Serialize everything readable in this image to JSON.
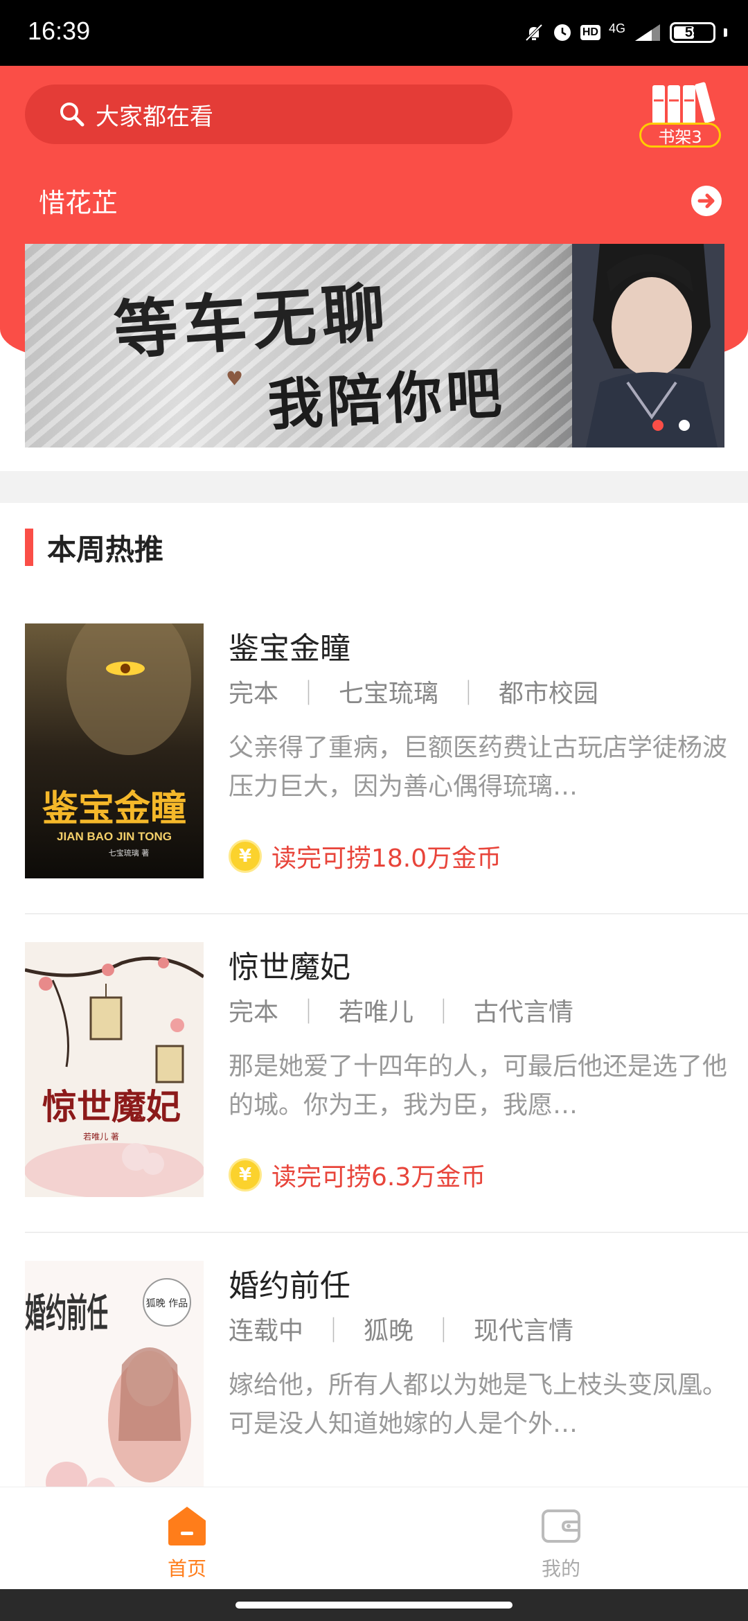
{
  "status_bar": {
    "time": "16:39",
    "network": "4G",
    "hd": "HD",
    "battery": "59",
    "battery_level": 0.59
  },
  "search": {
    "placeholder": "大家都在看"
  },
  "bookshelf": {
    "label": "书架3"
  },
  "author": {
    "name": "惜花芷"
  },
  "banner": {
    "line1": "等车无聊",
    "line2": "我陪你吧",
    "slides": 2,
    "active_slide": 1
  },
  "section": {
    "title": "本周热推"
  },
  "books": [
    {
      "title": "鉴宝金瞳",
      "status": "完本",
      "author": "七宝琉璃",
      "category": "都市校园",
      "desc": "父亲得了重病，巨额医药费让古玩店学徒杨波压力巨大，因为善心偶得琉璃…",
      "reward": "读完可捞18.0万金币",
      "cover_title": "鉴宝金瞳",
      "cover_pinyin": "JIAN BAO JIN TONG",
      "cover_author": "七宝琉璃 著"
    },
    {
      "title": "惊世魔妃",
      "status": "完本",
      "author": "若唯儿",
      "category": "古代言情",
      "desc": "那是她爱了十四年的人，可最后他还是选了他的城。你为王，我为臣，我愿…",
      "reward": "读完可捞6.3万金币",
      "cover_title": "惊世魔妃",
      "cover_author": "若唯儿 著"
    },
    {
      "title": "婚约前任",
      "status": "连载中",
      "author": "狐晚",
      "category": "现代言情",
      "desc": "嫁给他，所有人都以为她是飞上枝头变凤凰。可是没人知道她嫁的人是个外…",
      "reward": "",
      "cover_title": "婚约前任",
      "cover_author": "狐晚 作品"
    }
  ],
  "nav": {
    "home": "首页",
    "mine": "我的"
  },
  "colors": {
    "primary": "#fa4e47",
    "accent": "#ff7d1a",
    "reward": "#e8443a"
  }
}
